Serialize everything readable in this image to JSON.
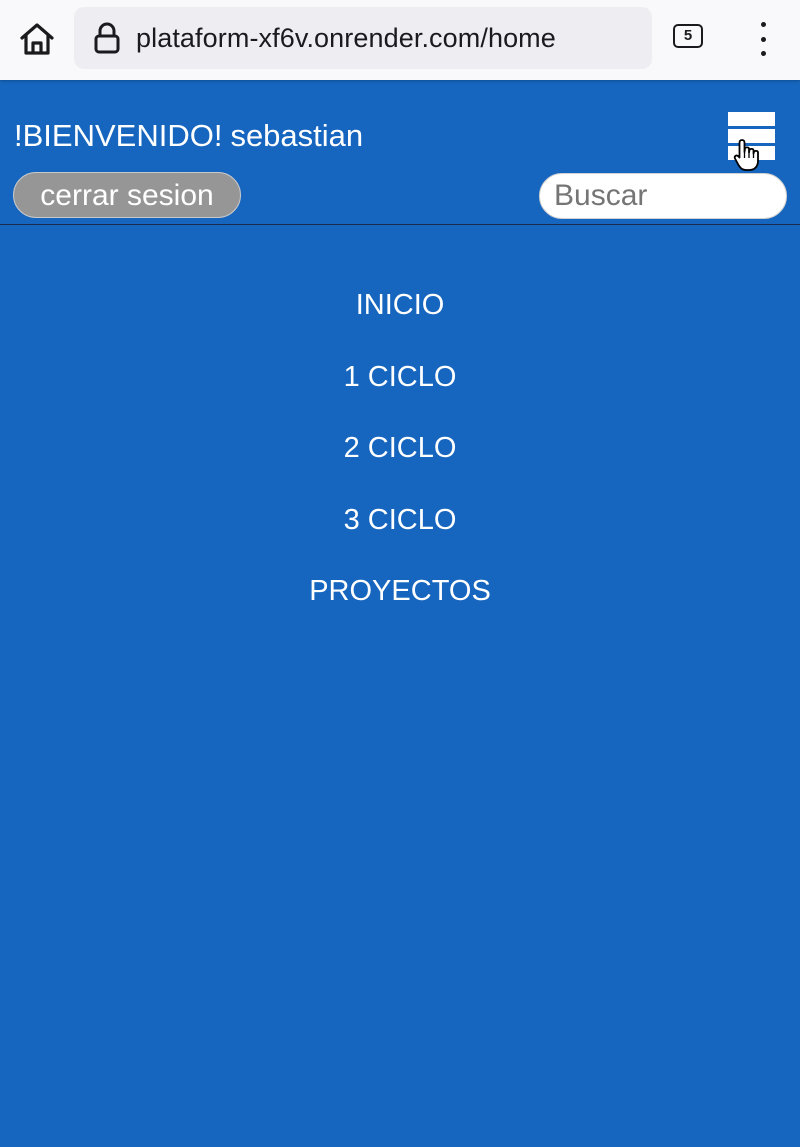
{
  "browser": {
    "url": "plataform-xf6v.onrender.com/home",
    "tab_count": "5",
    "icons": [
      "home-icon",
      "lock-icon",
      "tabs-icon",
      "more-vert-icon"
    ]
  },
  "header": {
    "greeting": "!BIENVENIDO!",
    "username": "sebastian",
    "logout_label": "cerrar sesion",
    "search_placeholder": "Buscar",
    "icons": [
      "hamburger-menu-icon",
      "hand-pointer-icon"
    ]
  },
  "nav": {
    "items": [
      {
        "label": "INICIO"
      },
      {
        "label": "1 CICLO"
      },
      {
        "label": "2 CICLO"
      },
      {
        "label": "3 CICLO"
      },
      {
        "label": "PROYECTOS"
      }
    ]
  },
  "colors": {
    "background": "#1666bf",
    "logout_button": "#969696",
    "browser_bar": "#f9f9fb",
    "url_box": "#eeeef2"
  }
}
